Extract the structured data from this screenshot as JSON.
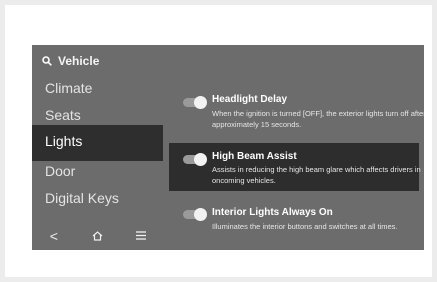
{
  "sidebar": {
    "search_label": "Vehicle",
    "items": [
      {
        "label": "Climate"
      },
      {
        "label": "Seats"
      },
      {
        "label": "Lights",
        "selected": true
      },
      {
        "label": "Door"
      },
      {
        "label": "Digital Keys"
      }
    ],
    "nav": {
      "back_glyph": "<",
      "home_icon": "home-icon",
      "menu_icon": "menu-icon"
    }
  },
  "settings": [
    {
      "title": "Headlight Delay",
      "description": "When the ignition is turned [OFF], the exterior lights turn off after approximately 15 seconds.",
      "toggle_on": true
    },
    {
      "title": "High Beam Assist",
      "description": "Assists in reducing the high beam glare which affects drivers in oncoming vehicles.",
      "toggle_on": true,
      "highlighted": true
    },
    {
      "title": "Interior Lights Always On",
      "description": "Illuminates the interior buttons and switches at all times.",
      "toggle_on": true
    }
  ],
  "colors": {
    "screen_bg": "#6c6c6c",
    "selected_bg": "#2e2e2e",
    "text": "#ffffff"
  }
}
